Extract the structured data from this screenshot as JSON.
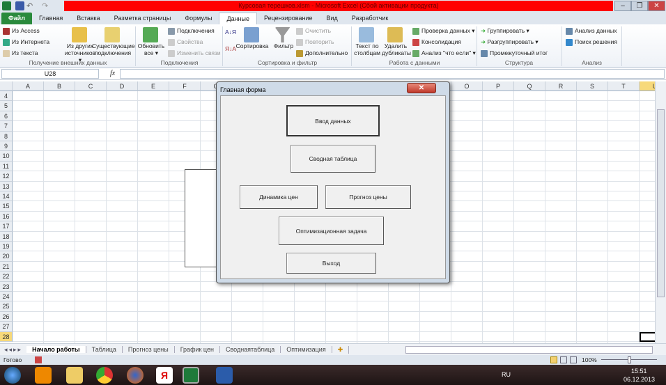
{
  "window": {
    "title": "Курсовая терешков.xlsm  -  Microsoft Excel (Сбой активации продукта)",
    "minimize": "–",
    "restore": "❐",
    "close": "✕"
  },
  "tabs": [
    "Файл",
    "Главная",
    "Вставка",
    "Разметка страницы",
    "Формулы",
    "Данные",
    "Рецензирование",
    "Вид",
    "Разработчик"
  ],
  "ribbon": {
    "external": {
      "access": "Из Access",
      "web": "Из Интернета",
      "text": "Из текста",
      "other": "Из других источников ▾",
      "existing": "Существующие подключения",
      "label": "Получение внешних данных"
    },
    "connections": {
      "refresh": "Обновить все ▾",
      "connections": "Подключения",
      "properties": "Свойства",
      "edit_links": "Изменить связи",
      "label": "Подключения"
    },
    "sort": {
      "sort": "Сортировка",
      "filter": "Фильтр",
      "clear": "Очистить",
      "reapply": "Повторить",
      "advanced": "Дополнительно",
      "label": "Сортировка и фильтр"
    },
    "datatools": {
      "text_to_columns": "Текст по столбцам",
      "remove_dup": "Удалить дубликаты",
      "validation": "Проверка данных ▾",
      "consolidate": "Консолидация",
      "whatif": "Анализ \"что если\" ▾",
      "label": "Работа с данными"
    },
    "outline": {
      "group": "Группировать ▾",
      "ungroup": "Разгруппировать ▾",
      "subtotal": "Промежуточный итог",
      "label": "Структура"
    },
    "analysis": {
      "data_analysis": "Анализ данных",
      "solver": "Поиск решения",
      "label": "Анализ"
    }
  },
  "formula_bar": {
    "name_box": "U28",
    "fx": "fx",
    "value": ""
  },
  "columns": [
    "A",
    "B",
    "C",
    "D",
    "E",
    "F",
    "G",
    "H",
    "I",
    "J",
    "K",
    "L",
    "M",
    "N",
    "O",
    "P",
    "Q",
    "R",
    "S",
    "T",
    "U"
  ],
  "rows": [
    "4",
    "5",
    "6",
    "7",
    "8",
    "9",
    "10",
    "11",
    "12",
    "13",
    "14",
    "15",
    "16",
    "17",
    "18",
    "19",
    "20",
    "21",
    "22",
    "23",
    "24",
    "25",
    "26",
    "27",
    "28"
  ],
  "dialog": {
    "title": "Главная форма",
    "close": "✕",
    "buttons": {
      "input": "Ввод данных",
      "pivot": "Сводная таблица",
      "dynamics": "Динамика цен",
      "forecast": "Прогноз цены",
      "optim": "Оптимизационная задача",
      "exit": "Выход"
    }
  },
  "sheet_tabs": [
    "Начало работы",
    "Таблица",
    "Прогноз цены",
    "График цен",
    "Своднаятаблица",
    "Оптимизация"
  ],
  "status": {
    "ready": "Готово",
    "zoom": "100%"
  },
  "taskbar": {
    "lang": "RU",
    "time": "15:51",
    "date": "06.12.2013"
  }
}
